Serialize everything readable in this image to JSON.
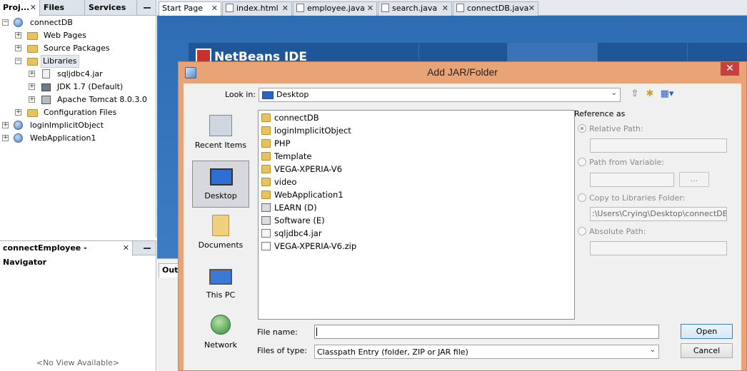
{
  "projects_panel": {
    "tabs": [
      "Proj...",
      "Files",
      "Services"
    ],
    "tree": [
      {
        "label": "connectDB",
        "depth": 0,
        "icon": "globe-icon"
      },
      {
        "label": "Web Pages",
        "depth": 1,
        "icon": "folder-icon"
      },
      {
        "label": "Source Packages",
        "depth": 1,
        "icon": "folder-icon"
      },
      {
        "label": "Libraries",
        "depth": 1,
        "icon": "folder-icon"
      },
      {
        "label": "sqljdbc4.jar",
        "depth": 2,
        "icon": "jar-icon"
      },
      {
        "label": "JDK 1.7 (Default)",
        "depth": 2,
        "icon": "jdk-icon"
      },
      {
        "label": "Apache Tomcat 8.0.3.0",
        "depth": 2,
        "icon": "server-icon"
      },
      {
        "label": "Configuration Files",
        "depth": 1,
        "icon": "folder-icon"
      },
      {
        "label": "loginImplicitObject",
        "depth": 0,
        "icon": "globe-icon"
      },
      {
        "label": "WebApplication1",
        "depth": 0,
        "icon": "globe-icon"
      }
    ]
  },
  "navigator": {
    "title": "connectEmployee - Navigator",
    "empty_text": "<No View Available>"
  },
  "editor_tabs": [
    "Start Page",
    "index.html",
    "employee.java",
    "search.java",
    "connectDB.java"
  ],
  "start_page": {
    "logo": "NetBeans IDE",
    "output_tab": "Output"
  },
  "dialog": {
    "title": "Add JAR/Folder",
    "look_in_label": "Look in:",
    "look_in_value": "Desktop",
    "places": [
      "Recent Items",
      "Desktop",
      "Documents",
      "This PC",
      "Network"
    ],
    "files": [
      {
        "name": "connectDB",
        "type": "folder"
      },
      {
        "name": "loginImplicitObject",
        "type": "folder"
      },
      {
        "name": "PHP",
        "type": "folder"
      },
      {
        "name": "Template",
        "type": "folder"
      },
      {
        "name": "VEGA-XPERIA-V6",
        "type": "folder"
      },
      {
        "name": "video",
        "type": "folder"
      },
      {
        "name": "WebApplication1",
        "type": "folder"
      },
      {
        "name": "LEARN (D)",
        "type": "drive"
      },
      {
        "name": "Software (E)",
        "type": "drive"
      },
      {
        "name": "sqljdbc4.jar",
        "type": "jar"
      },
      {
        "name": "VEGA-XPERIA-V6.zip",
        "type": "zip"
      }
    ],
    "reference_as": "Reference as",
    "relative_path": "Relative Path:",
    "path_from_variable": "Path from Variable:",
    "browse_button": "...",
    "copy_to_libraries": "Copy to Libraries Folder:",
    "copy_path_value": ":\\Users\\Crying\\Desktop\\connectDB\\lib",
    "absolute_path": "Absolute Path:",
    "file_name_label": "File name:",
    "file_name_value": "",
    "files_of_type_label": "Files of type:",
    "files_of_type_value": "Classpath Entry (folder, ZIP or JAR file)",
    "open_button": "Open",
    "cancel_button": "Cancel"
  }
}
